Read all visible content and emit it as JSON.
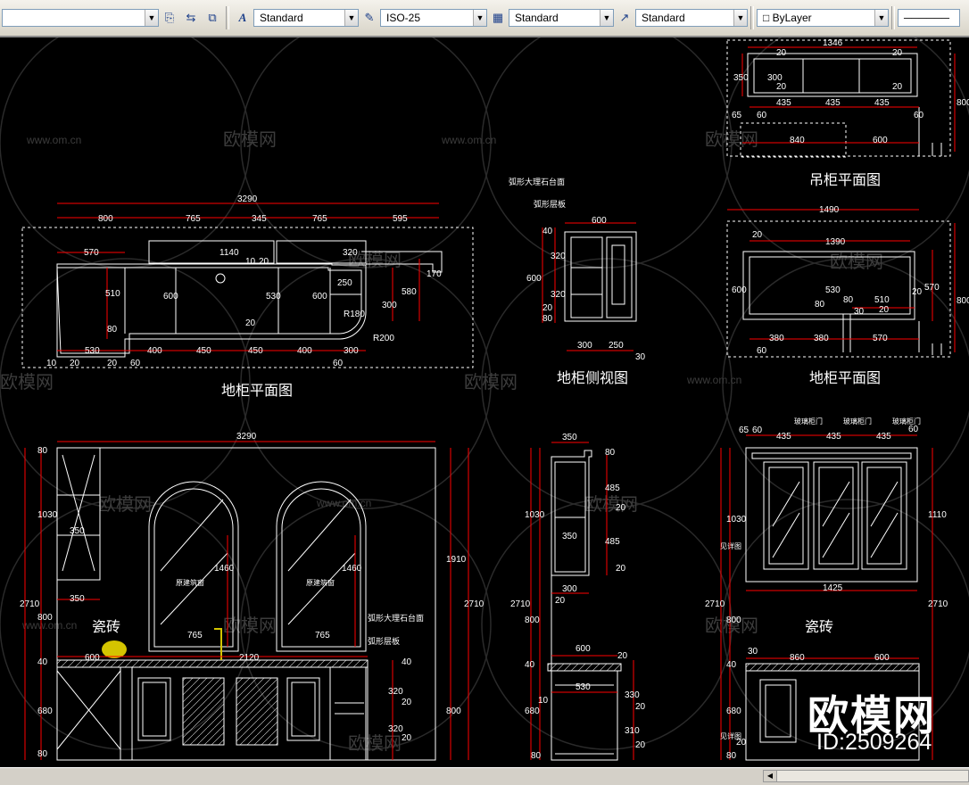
{
  "toolbar": {
    "text_style": "Standard",
    "dim_style": "ISO-25",
    "table_style": "Standard",
    "multileader_style": "Standard",
    "layer": "ByLayer",
    "icons": [
      "multiline-text-icon",
      "properties-icon",
      "match-properties-icon",
      "text-style-icon",
      "dim-style-icon",
      "table-style-icon",
      "multileader-style-icon"
    ]
  },
  "watermarks": {
    "brand": "欧模网",
    "site": "www.om.cn",
    "id": "ID:2509264"
  },
  "drawing": {
    "plan_top": {
      "title": "吊柜平面图",
      "dims": [
        "1346",
        "350",
        "300",
        "20",
        "20",
        "20",
        "20",
        "435",
        "435",
        "435",
        "65",
        "60",
        "60",
        "840",
        "600",
        "800"
      ]
    },
    "plan_right": {
      "title": "地柜平面图",
      "dims": [
        "1490",
        "20",
        "1390",
        "570",
        "600",
        "530",
        "80",
        "510",
        "20",
        "380",
        "380",
        "570",
        "60",
        "80",
        "20",
        "30",
        "800"
      ]
    },
    "plan_left": {
      "title": "地柜平面图",
      "dims": [
        "3290",
        "800",
        "765",
        "345",
        "765",
        "595",
        "570",
        "1140",
        "10",
        "20",
        "320",
        "170",
        "250",
        "510",
        "600",
        "530",
        "600",
        "80",
        "20",
        "300",
        "580",
        "R180",
        "R200",
        "530",
        "400",
        "450",
        "450",
        "400",
        "300",
        "10",
        "20",
        "20",
        "60",
        "60"
      ]
    },
    "side_view": {
      "title": "地柜侧视图",
      "notes": [
        "弧形大理石台面",
        "弧形层板"
      ],
      "dims": [
        "600",
        "40",
        "320",
        "600",
        "320",
        "20",
        "80",
        "300",
        "250",
        "30"
      ]
    },
    "elev_left": {
      "tile": "瓷砖",
      "window_label": "原建筑窗",
      "notes": [
        "弧形大理石台面",
        "弧形层板"
      ],
      "dims": [
        "3290",
        "80",
        "1030",
        "350",
        "350",
        "2710",
        "800",
        "40",
        "680",
        "80",
        "1460",
        "1460",
        "765",
        "765",
        "600",
        "2120",
        "1910",
        "2710",
        "40",
        "320",
        "20",
        "320",
        "800",
        "20"
      ]
    },
    "elev_mid": {
      "dims": [
        "350",
        "80",
        "485",
        "20",
        "350",
        "485",
        "20",
        "1030",
        "2710",
        "300",
        "20",
        "800",
        "600",
        "20",
        "40",
        "530",
        "330",
        "680",
        "10",
        "20",
        "310",
        "20",
        "80"
      ]
    },
    "elev_right": {
      "tile": "瓷砖",
      "door_labels": [
        "玻璃柜门",
        "玻璃柜门",
        "玻璃柜门"
      ],
      "side_labels": [
        "见详图",
        "见详图"
      ],
      "dims": [
        "65",
        "60",
        "435",
        "435",
        "435",
        "60",
        "1030",
        "1110",
        "2710",
        "1425",
        "800",
        "30",
        "860",
        "600",
        "40",
        "680",
        "20",
        "80",
        "2710"
      ]
    }
  }
}
